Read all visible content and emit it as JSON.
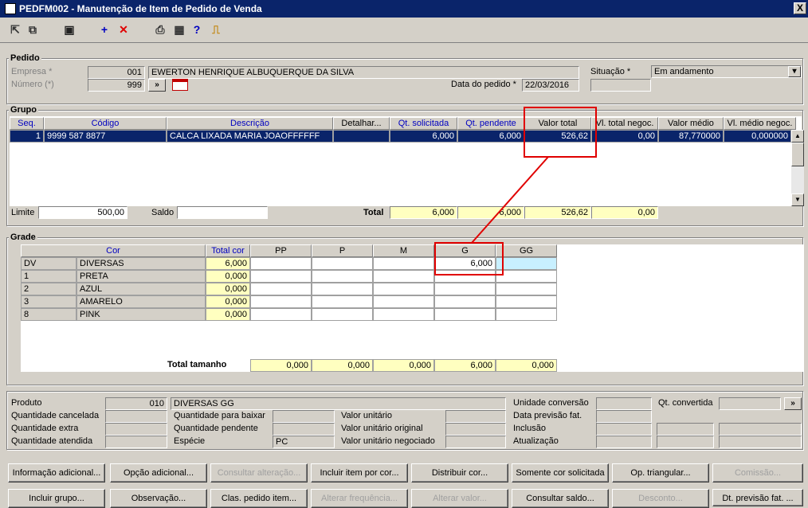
{
  "window": {
    "title": "PEDFM002 - Manutenção de Item de Pedido de Venda",
    "close": "X"
  },
  "toolbar": {
    "icons": [
      "exit-icon",
      "copy-icon",
      "save-icon",
      "add-icon",
      "delete-icon",
      "print-icon",
      "table-icon",
      "help-icon",
      "door-icon"
    ]
  },
  "pedido": {
    "section": "Pedido",
    "empresa_label": "Empresa *",
    "empresa_code": "001",
    "empresa_name": "EWERTON HENRIQUE ALBUQUERQUE DA SILVA",
    "numero_label": "Número (*)",
    "numero_value": "999",
    "go_label": "»",
    "data_label": "Data do pedido *",
    "data_value": "22/03/2016",
    "situacao_label": "Situação *",
    "situacao_value": "Em andamento",
    "situacao_arrow": "▾"
  },
  "grupo": {
    "section": "Grupo",
    "headers": [
      "Seq.",
      "Código",
      "Descrição",
      "Detalhar...",
      "Qt. solicitada",
      "Qt. pendente",
      "Valor total",
      "Vl. total negoc.",
      "Valor médio",
      "Vl. médio negoc."
    ],
    "row": [
      "1",
      "9999 587 8877",
      "CALCA LIXADA MARIA JOAOFFFFFF",
      "",
      "6,000",
      "6,000",
      "526,62",
      "0,00",
      "87,770000",
      "0,000000"
    ],
    "limite_label": "Limite",
    "limite_value": "500,00",
    "saldo_label": "Saldo",
    "saldo_value": "",
    "total_label": "Total",
    "totals": [
      "6,000",
      "6,000",
      "526,62",
      "0,00"
    ]
  },
  "grade": {
    "section": "Grade",
    "headers": [
      "Cor",
      "Total cor",
      "PP",
      "P",
      "M",
      "G",
      "GG"
    ],
    "rows": [
      {
        "code": "DV",
        "name": "DIVERSAS",
        "total": "6,000",
        "g": "6,000"
      },
      {
        "code": "1",
        "name": "PRETA",
        "total": "0,000",
        "g": ""
      },
      {
        "code": "2",
        "name": "AZUL",
        "total": "0,000",
        "g": ""
      },
      {
        "code": "3",
        "name": "AMARELO",
        "total": "0,000",
        "g": ""
      },
      {
        "code": "8",
        "name": "PINK",
        "total": "0,000",
        "g": ""
      }
    ],
    "total_tamanho_label": "Total tamanho",
    "total_tamanho": [
      "0,000",
      "0,000",
      "0,000",
      "6,000",
      "0,000"
    ]
  },
  "detalhe": {
    "produto_label": "Produto",
    "produto_code": "010",
    "produto_desc": "DIVERSAS GG",
    "qtd_cancelada_label": "Quantidade cancelada",
    "qtd_extra_label": "Quantidade extra",
    "qtd_atendida_label": "Quantidade atendida",
    "qtd_baixar_label": "Quantidade para baixar",
    "qtd_pendente_label": "Quantidade pendente",
    "especie_label": "Espécie",
    "especie_value": "PC",
    "valor_unitario_label": "Valor unitário",
    "valor_unit_original_label": "Valor unitário original",
    "valor_unit_negociado_label": "Valor unitário negociado",
    "unidade_conversao_label": "Unidade conversão",
    "data_previsao_label": "Data previsão fat.",
    "inclusao_label": "Inclusão",
    "atualizacao_label": "Atualização",
    "qt_convertida_label": "Qt. convertida",
    "go_label": "»"
  },
  "buttons": {
    "row1": [
      "Informação adicional...",
      "Opção adicional...",
      "Consultar alteração...",
      "Incluir item por cor...",
      "Distribuir cor...",
      "Somente cor solicitada",
      "Op. triangular...",
      "Comissão..."
    ],
    "row2": [
      "Incluir grupo...",
      "Observação...",
      "Clas. pedido item...",
      "Alterar frequência...",
      "Alterar valor...",
      "Consultar saldo...",
      "Desconto...",
      "Dt. previsão fat. ..."
    ]
  }
}
